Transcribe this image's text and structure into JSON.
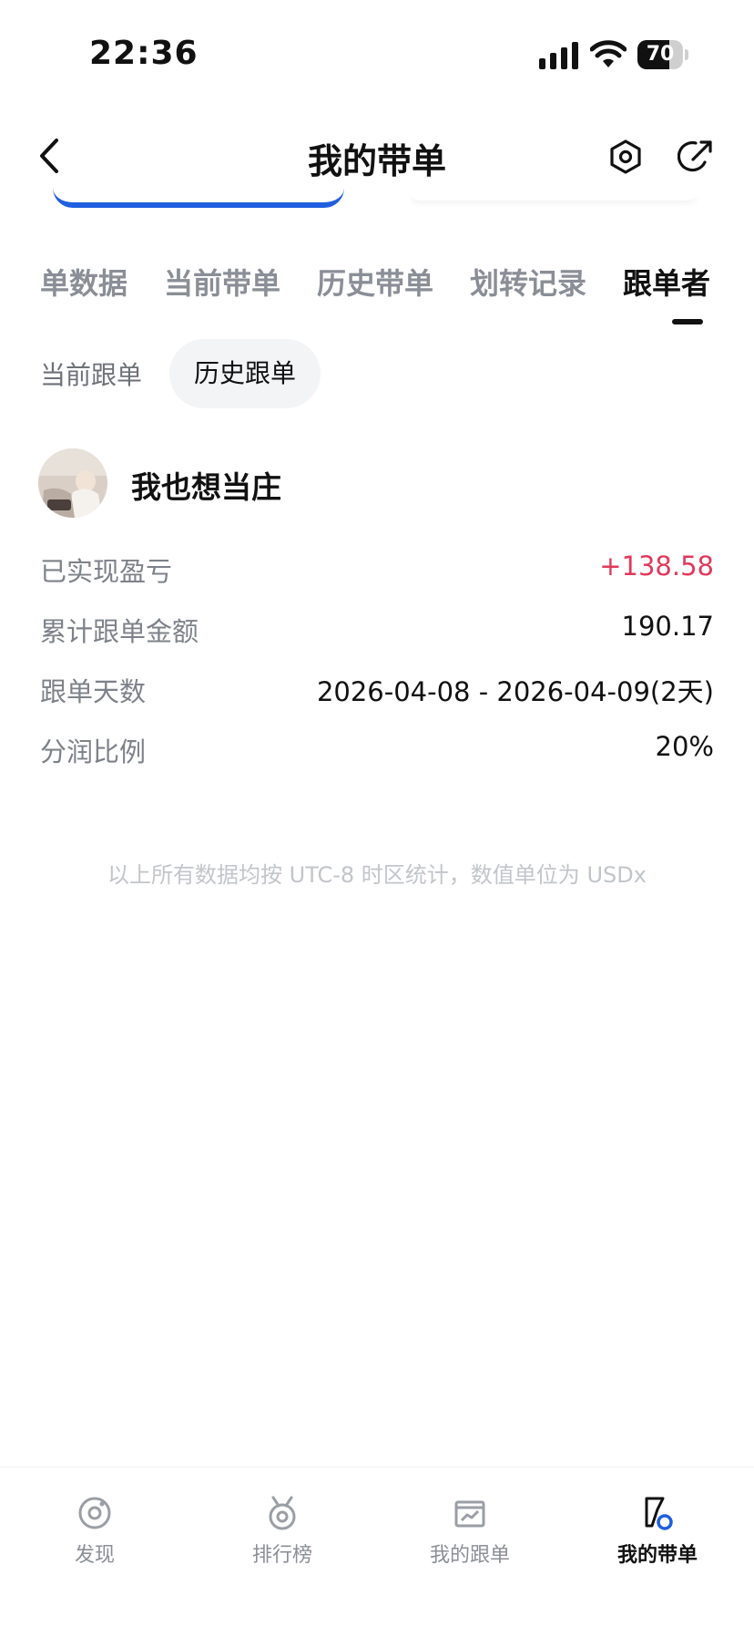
{
  "status_bar": {
    "time": "22:36",
    "battery": "70"
  },
  "header": {
    "title": "我的带单"
  },
  "tabs": [
    {
      "label": "单数据"
    },
    {
      "label": "当前带单"
    },
    {
      "label": "历史带单"
    },
    {
      "label": "划转记录"
    },
    {
      "label": "跟单者",
      "active": true
    }
  ],
  "sub_tabs": [
    {
      "label": "当前跟单"
    },
    {
      "label": "历史跟单",
      "active": true
    }
  ],
  "follower": {
    "name": "我也想当庄",
    "rows": [
      {
        "label": "已实现盈亏",
        "value": "+138.58"
      },
      {
        "label": "累计跟单金额",
        "value": "190.17"
      },
      {
        "label": "跟单天数",
        "value": "2026-04-08 - 2026-04-09(2天)"
      },
      {
        "label": "分润比例",
        "value": "20%"
      }
    ]
  },
  "footnote": "以上所有数据均按 UTC-8 时区统计，数值单位为 USDx",
  "bottom_nav": [
    {
      "label": "发现",
      "icon": "discover-icon"
    },
    {
      "label": "排行榜",
      "icon": "leaderboard-medal-icon"
    },
    {
      "label": "我的跟单",
      "icon": "my-copy-trades-icon"
    },
    {
      "label": "我的带单",
      "icon": "my-lead-trades-icon",
      "active": true
    }
  ],
  "colors": {
    "accent_blue": "#1f5fe0",
    "profit_red": "#e03a5c"
  }
}
